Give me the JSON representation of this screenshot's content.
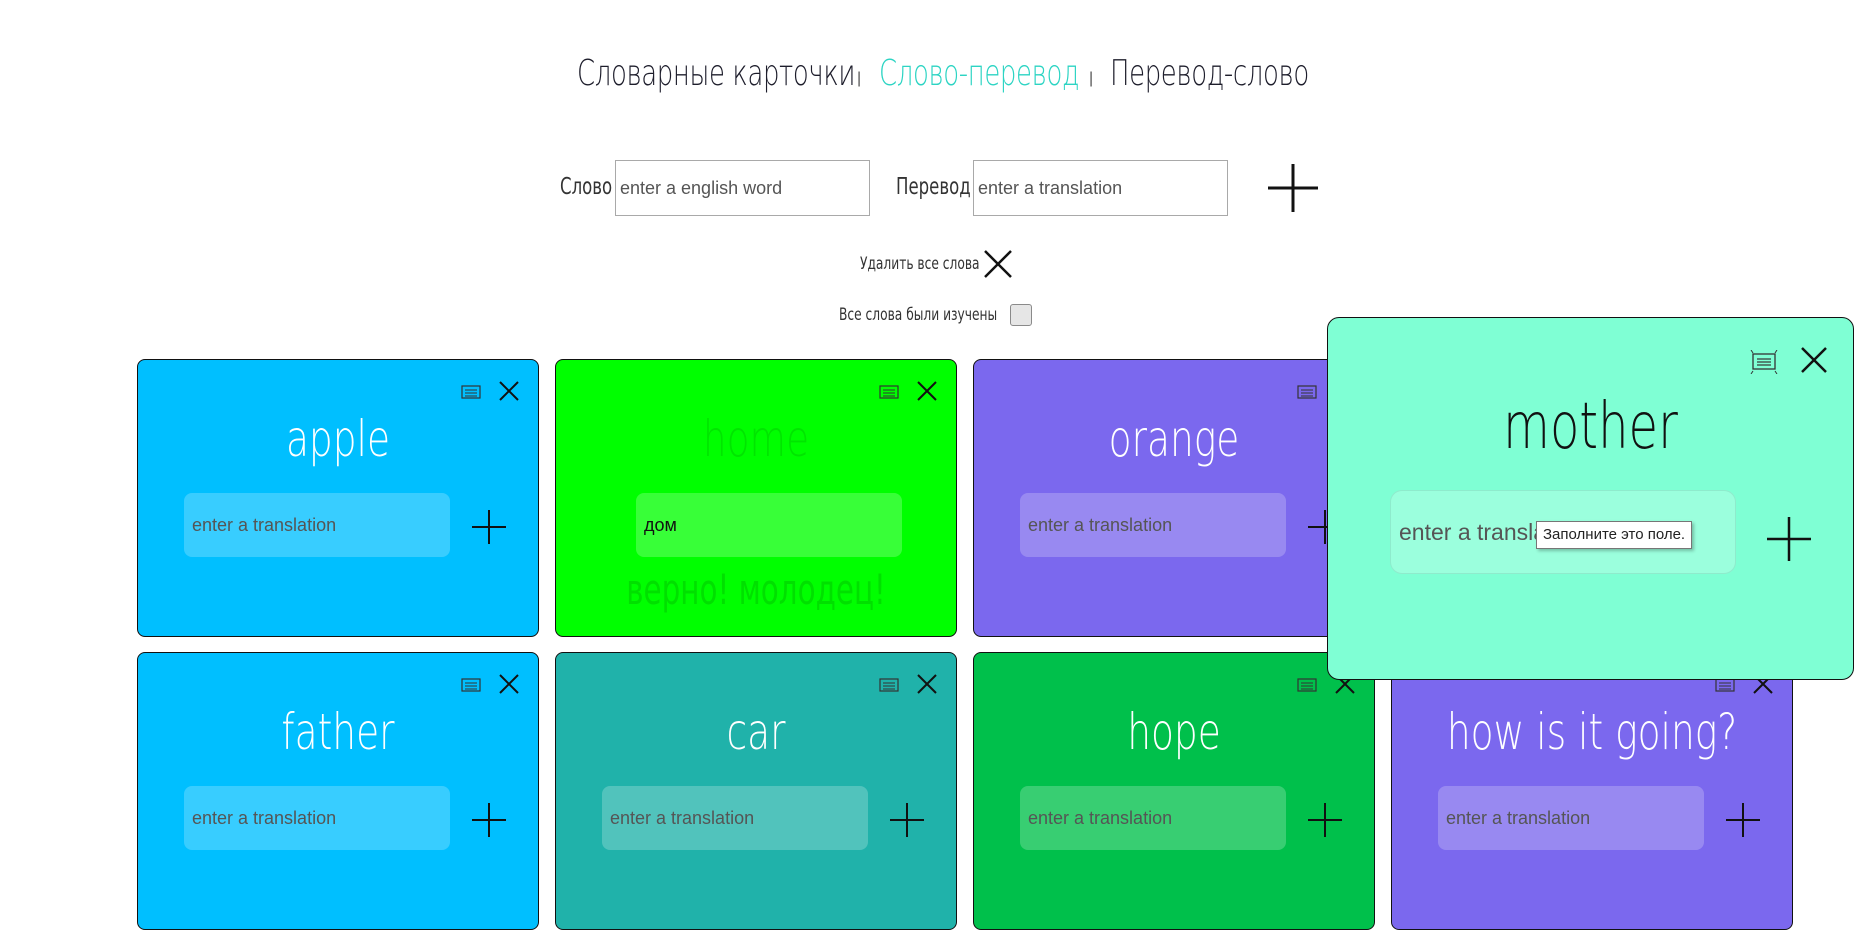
{
  "nav": {
    "tab_flashcards": "Словарные карточки",
    "tab_word_translation": "Слово-перевод",
    "tab_translation_word": "Перевод-слово",
    "separator": "|"
  },
  "form": {
    "word_label": "Слово",
    "word_placeholder": "enter a english word",
    "translation_label": "Перевод",
    "translation_placeholder": "enter a translation",
    "add_icon": "plus-icon"
  },
  "controls": {
    "delete_all_label": "Удалить все слова",
    "delete_all_icon": "close-icon",
    "all_learned_label": "Все слова были изучены"
  },
  "cards": [
    {
      "word": "apple",
      "color": "#00bfff",
      "placeholder": "enter a translation",
      "value": ""
    },
    {
      "word": "home",
      "color": "#00ff00",
      "placeholder": "enter a translation",
      "value": "дом",
      "feedback": "верно! молодец!"
    },
    {
      "word": "orange",
      "color": "#7b68ee",
      "placeholder": "enter a translation",
      "value": ""
    },
    {
      "word": "father",
      "color": "#00bfff",
      "placeholder": "enter a translation",
      "value": ""
    },
    {
      "word": "car",
      "color": "#20b2aa",
      "placeholder": "enter a translation",
      "value": ""
    },
    {
      "word": "hope",
      "color": "#00c04b",
      "placeholder": "enter a translation",
      "value": ""
    },
    {
      "word": "how is it going?",
      "color": "#7b68ee",
      "placeholder": "enter a translation",
      "value": ""
    }
  ],
  "popup": {
    "word": "mother",
    "color": "#7fffd4",
    "placeholder": "enter a translation",
    "tooltip": "Заполните это поле."
  }
}
